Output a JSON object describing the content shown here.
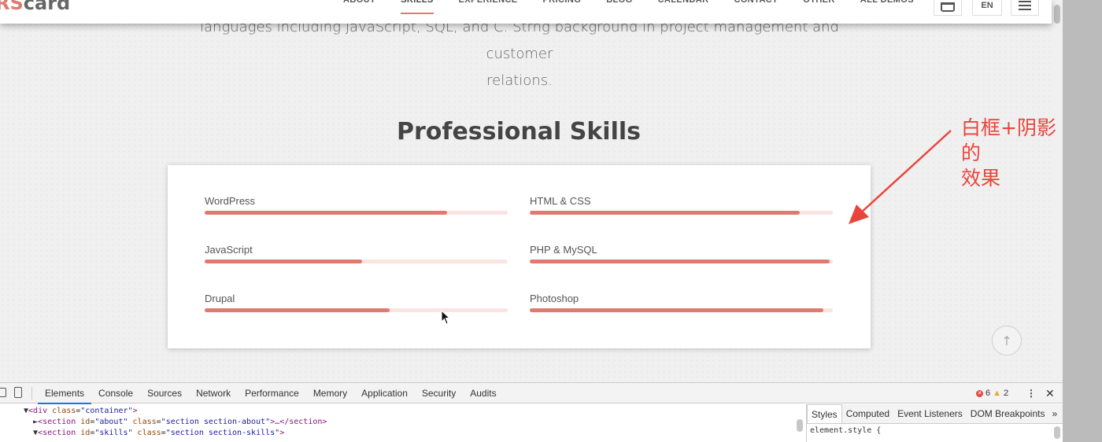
{
  "nav": {
    "logo_accent": "RS",
    "logo_rest": "card",
    "links": [
      "ABOUT",
      "SKILLS",
      "EXPERIENCE",
      "PRICING",
      "BLOG",
      "CALENDAR",
      "CONTACT",
      "OTHER",
      "ALL DEMOS"
    ],
    "active_link": "SKILLS",
    "lang": "EN",
    "cart_icon": "basket-icon",
    "menu_icon": "hamburger-icon"
  },
  "about": {
    "text_line1": "languages including JavaScript, SQL, and C. Strng background in project management and customer",
    "text_line2": "relations."
  },
  "skills": {
    "title": "Professional Skills",
    "items": [
      {
        "name": "WordPress",
        "level": 0.8
      },
      {
        "name": "HTML & CSS",
        "level": 0.89
      },
      {
        "name": "JavaScript",
        "level": 0.52
      },
      {
        "name": "PHP & MySQL",
        "level": 0.99
      },
      {
        "name": "Drupal",
        "level": 0.61
      },
      {
        "name": "Photoshop",
        "level": 0.97
      }
    ]
  },
  "annotation": {
    "line1": "白框+阴影的",
    "line2": "效果",
    "color": "#e8453c"
  },
  "colors": {
    "accent": "#e07a6f",
    "track": "#fbe3e2"
  },
  "devtools": {
    "tabs": [
      "Elements",
      "Console",
      "Sources",
      "Network",
      "Performance",
      "Memory",
      "Application",
      "Security",
      "Audits"
    ],
    "active_tab": "Elements",
    "errors": "6",
    "warnings": "2",
    "dom_lines": [
      {
        "indent": "▼",
        "tag": "div",
        "attrs": [
          [
            "class",
            "container"
          ]
        ],
        "tail": ">"
      },
      {
        "indent": "  ►",
        "tag": "section",
        "attrs": [
          [
            "id",
            "about"
          ],
          [
            "class",
            "section section-about"
          ]
        ],
        "tail": ">…</section>"
      },
      {
        "indent": "  ▼",
        "tag": "section",
        "attrs": [
          [
            "id",
            "skills"
          ],
          [
            "class",
            "section section-skills"
          ]
        ],
        "tail": ">"
      }
    ],
    "styles_tabs": [
      "Styles",
      "Computed",
      "Event Listeners",
      "DOM Breakpoints"
    ],
    "styles_active": "Styles",
    "element_style": "element.style {"
  }
}
